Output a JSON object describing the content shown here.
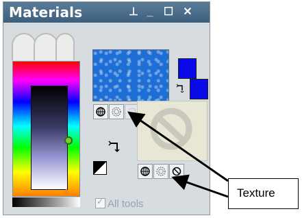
{
  "panel": {
    "title": "Materials",
    "buttons": {
      "pin": "⊥",
      "minimize": "_",
      "maximize": "☐",
      "close": "✕"
    }
  },
  "swatch": {
    "texture_color": "#1d6fd6",
    "foreground_color": "#0a0ae8",
    "background_color": "#0a0ae8"
  },
  "options": {
    "all_tools_label": "All tools",
    "all_tools_checked": true
  },
  "callout": {
    "label": "Texture"
  },
  "colors": {
    "panel_bg": "#d7dce0",
    "title_bar": "#4a6b88",
    "hue_marker": "#7ccc2a",
    "lightness_marker": "#f08a18"
  }
}
